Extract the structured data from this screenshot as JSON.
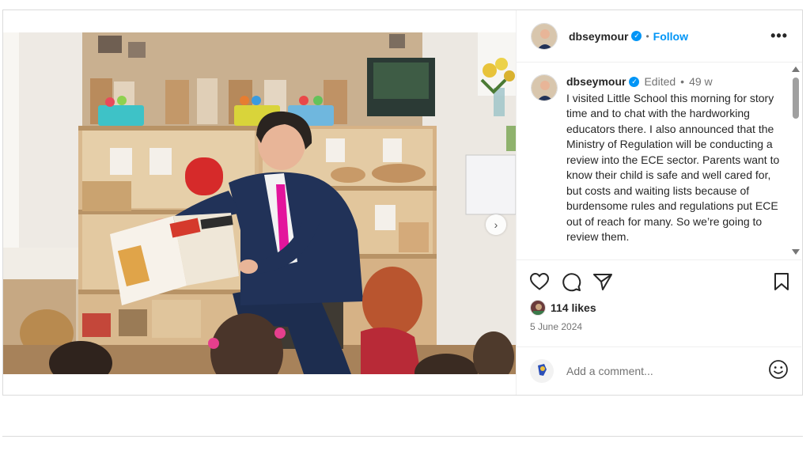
{
  "post": {
    "username": "dbseymour",
    "follow_label": "Follow",
    "separator": "•",
    "more_label": "•••",
    "caption": {
      "username": "dbseymour",
      "edited": "Edited",
      "dot": "•",
      "age": "49 w",
      "text": "I visited Little School this morning for story time and to chat with the hardworking educators there. I also announced that the Ministry of Regulation will be conducting a review into the ECE sector. Parents want to know their child is safe and well cared for, but costs and waiting lists because of burdensome rules and regulations put ECE out of reach for many. So we’re going to review them."
    },
    "likes": "114 likes",
    "date": "5 June 2024",
    "comment_placeholder": "Add a comment...",
    "carousel": {
      "slides": 2,
      "active_index": 0
    },
    "colors": {
      "accent": "#0095f6",
      "tie": "#e3159c",
      "suit": "#1f2f52"
    }
  }
}
